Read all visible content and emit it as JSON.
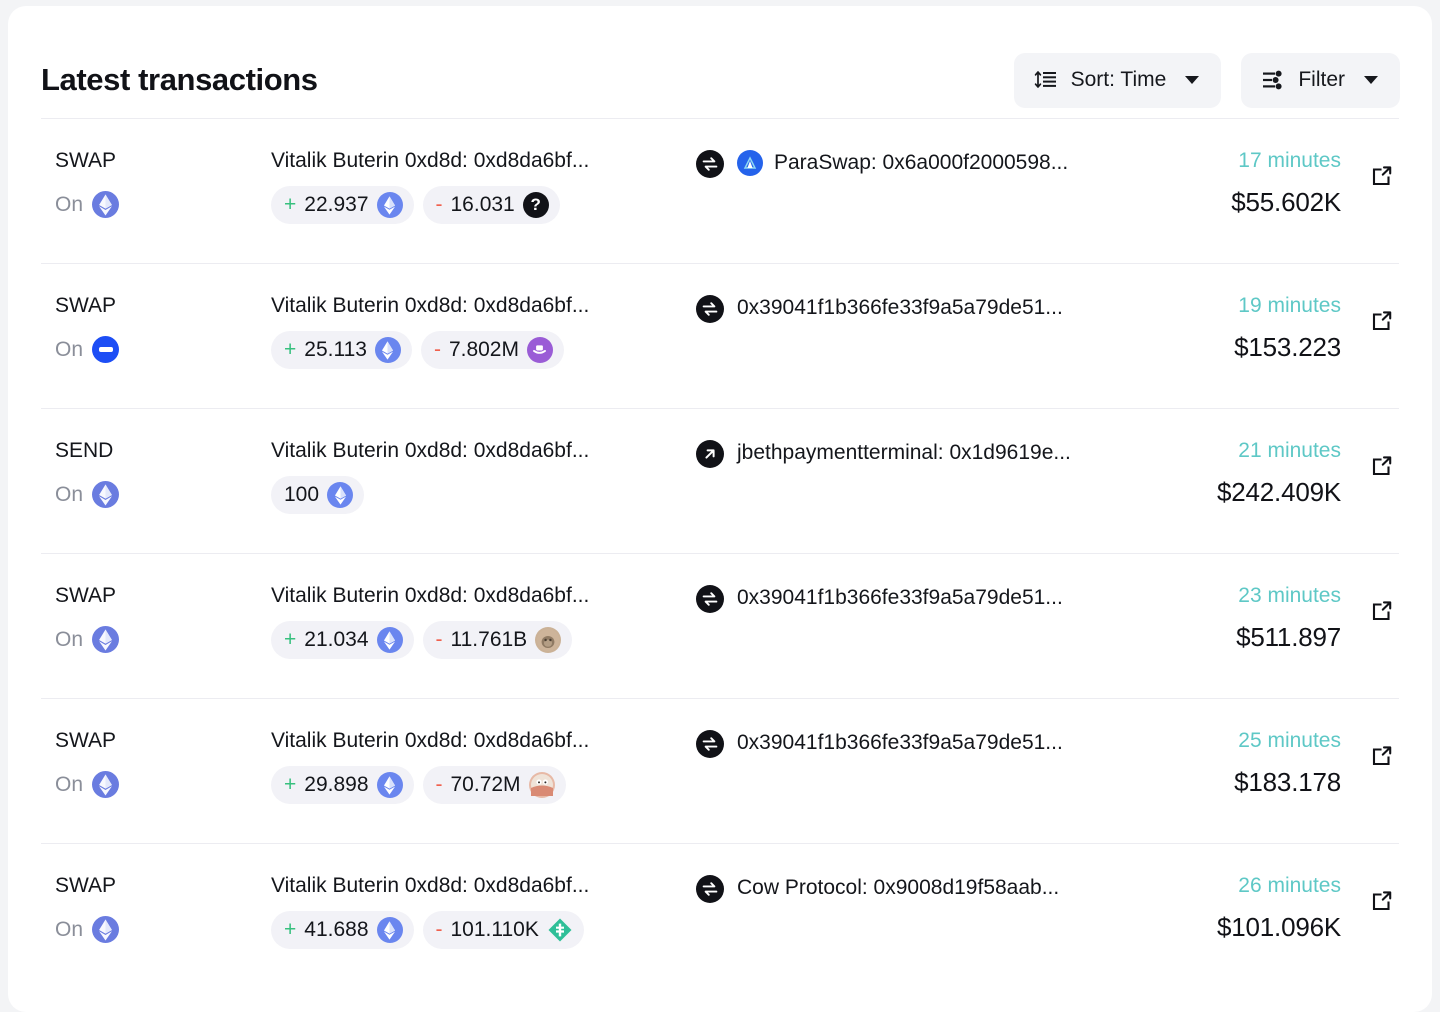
{
  "header": {
    "title": "Latest transactions",
    "sort_button": {
      "label": "Sort: Time",
      "icon": "sort-icon"
    },
    "filter_button": {
      "label": "Filter",
      "icon": "filter-icon"
    }
  },
  "rows": [
    {
      "type": "SWAP",
      "on_label": "On",
      "chain": "ethereum",
      "account": "Vitalik Buterin 0xd8d: 0xd8da6bf...",
      "amounts": [
        {
          "sign": "+",
          "value": "22.937",
          "token": "eth"
        },
        {
          "sign": "-",
          "value": "16.031",
          "token": "unknown"
        }
      ],
      "action_icon": "swap-icon",
      "counterparty_icon": "paraswap-icon",
      "counterparty": "ParaSwap: 0x6a000f2000598...",
      "time": "17 minutes",
      "usd": "$55.602K",
      "external_link": "open-in-new-icon"
    },
    {
      "type": "SWAP",
      "on_label": "On",
      "chain": "base",
      "account": "Vitalik Buterin 0xd8d: 0xd8da6bf...",
      "amounts": [
        {
          "sign": "+",
          "value": "25.113",
          "token": "eth"
        },
        {
          "sign": "-",
          "value": "7.802M",
          "token": "degen"
        }
      ],
      "action_icon": "swap-icon",
      "counterparty_icon": null,
      "counterparty": "0x39041f1b366fe33f9a5a79de51...",
      "time": "19 minutes",
      "usd": "$153.223",
      "external_link": "open-in-new-icon"
    },
    {
      "type": "SEND",
      "on_label": "On",
      "chain": "ethereum",
      "account": "Vitalik Buterin 0xd8d: 0xd8da6bf...",
      "amounts": [
        {
          "sign": "",
          "value": "100",
          "token": "eth"
        }
      ],
      "action_icon": "arrow-up-right-icon",
      "counterparty_icon": null,
      "counterparty": "jbethpaymentterminal: 0x1d9619e...",
      "time": "21 minutes",
      "usd": "$242.409K",
      "external_link": "open-in-new-icon"
    },
    {
      "type": "SWAP",
      "on_label": "On",
      "chain": "ethereum",
      "account": "Vitalik Buterin 0xd8d: 0xd8da6bf...",
      "amounts": [
        {
          "sign": "+",
          "value": "21.034",
          "token": "eth"
        },
        {
          "sign": "-",
          "value": "11.761B",
          "token": "ape"
        }
      ],
      "action_icon": "swap-icon",
      "counterparty_icon": null,
      "counterparty": "0x39041f1b366fe33f9a5a79de51...",
      "time": "23 minutes",
      "usd": "$511.897",
      "external_link": "open-in-new-icon"
    },
    {
      "type": "SWAP",
      "on_label": "On",
      "chain": "ethereum",
      "account": "Vitalik Buterin 0xd8d: 0xd8da6bf...",
      "amounts": [
        {
          "sign": "+",
          "value": "29.898",
          "token": "eth"
        },
        {
          "sign": "-",
          "value": "70.72M",
          "token": "pepe"
        }
      ],
      "action_icon": "swap-icon",
      "counterparty_icon": null,
      "counterparty": "0x39041f1b366fe33f9a5a79de51...",
      "time": "25 minutes",
      "usd": "$183.178",
      "external_link": "open-in-new-icon"
    },
    {
      "type": "SWAP",
      "on_label": "On",
      "chain": "ethereum",
      "account": "Vitalik Buterin 0xd8d: 0xd8da6bf...",
      "amounts": [
        {
          "sign": "+",
          "value": "41.688",
          "token": "eth"
        },
        {
          "sign": "-",
          "value": "101.110K",
          "token": "safe"
        }
      ],
      "action_icon": "swap-icon",
      "counterparty_icon": null,
      "counterparty": "Cow Protocol: 0x9008d19f58aab...",
      "time": "26 minutes",
      "usd": "$101.096K",
      "external_link": "open-in-new-icon"
    }
  ],
  "colors": {
    "positive": "#37c07e",
    "negative": "#f0604d",
    "time": "#5ec8c6",
    "text": "#14161b",
    "muted": "#8a8e99",
    "chip_bg": "#f2f2f7",
    "button_bg": "#f3f4f7"
  }
}
